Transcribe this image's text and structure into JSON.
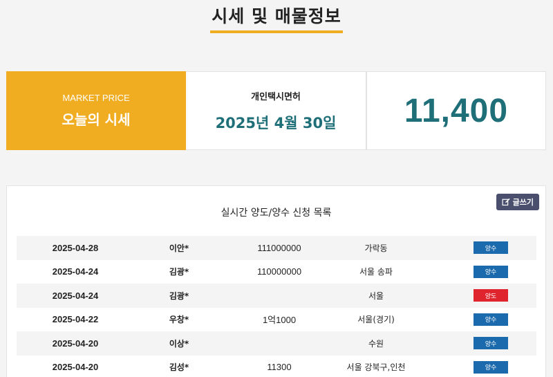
{
  "header": {
    "title": "시세 및 매물정보"
  },
  "market": {
    "label": "MARKET PRICE",
    "title": "오늘의 시세",
    "license_label": "개인택시면허",
    "date": "2025년 4월 30일",
    "price": "11,400"
  },
  "list": {
    "title": "실시간 양도/양수 신청 목록",
    "write_label": "글쓰기",
    "rows": [
      {
        "date": "2025-04-28",
        "name": "이안*",
        "price": "111000000",
        "region": "가락동",
        "type": "양수",
        "kind": "buy"
      },
      {
        "date": "2025-04-24",
        "name": "김광*",
        "price": "110000000",
        "region": "서울 송파",
        "type": "양수",
        "kind": "buy"
      },
      {
        "date": "2025-04-24",
        "name": "김광*",
        "price": "",
        "region": "서울",
        "type": "양도",
        "kind": "sell"
      },
      {
        "date": "2025-04-22",
        "name": "우창*",
        "price": "1억1000",
        "region": "서울(경기)",
        "type": "양수",
        "kind": "buy"
      },
      {
        "date": "2025-04-20",
        "name": "이상*",
        "price": "",
        "region": "수원",
        "type": "양수",
        "kind": "buy"
      },
      {
        "date": "2025-04-20",
        "name": "김성*",
        "price": "11300",
        "region": "서울 강북구,인천",
        "type": "양수",
        "kind": "buy"
      }
    ]
  },
  "colors": {
    "accent": "#f0ad22",
    "teal": "#1e6f78",
    "buy": "#1b6aad",
    "sell": "#e0242e",
    "write_button": "#4a4f6e"
  },
  "icons": {
    "write": "edit-icon"
  }
}
